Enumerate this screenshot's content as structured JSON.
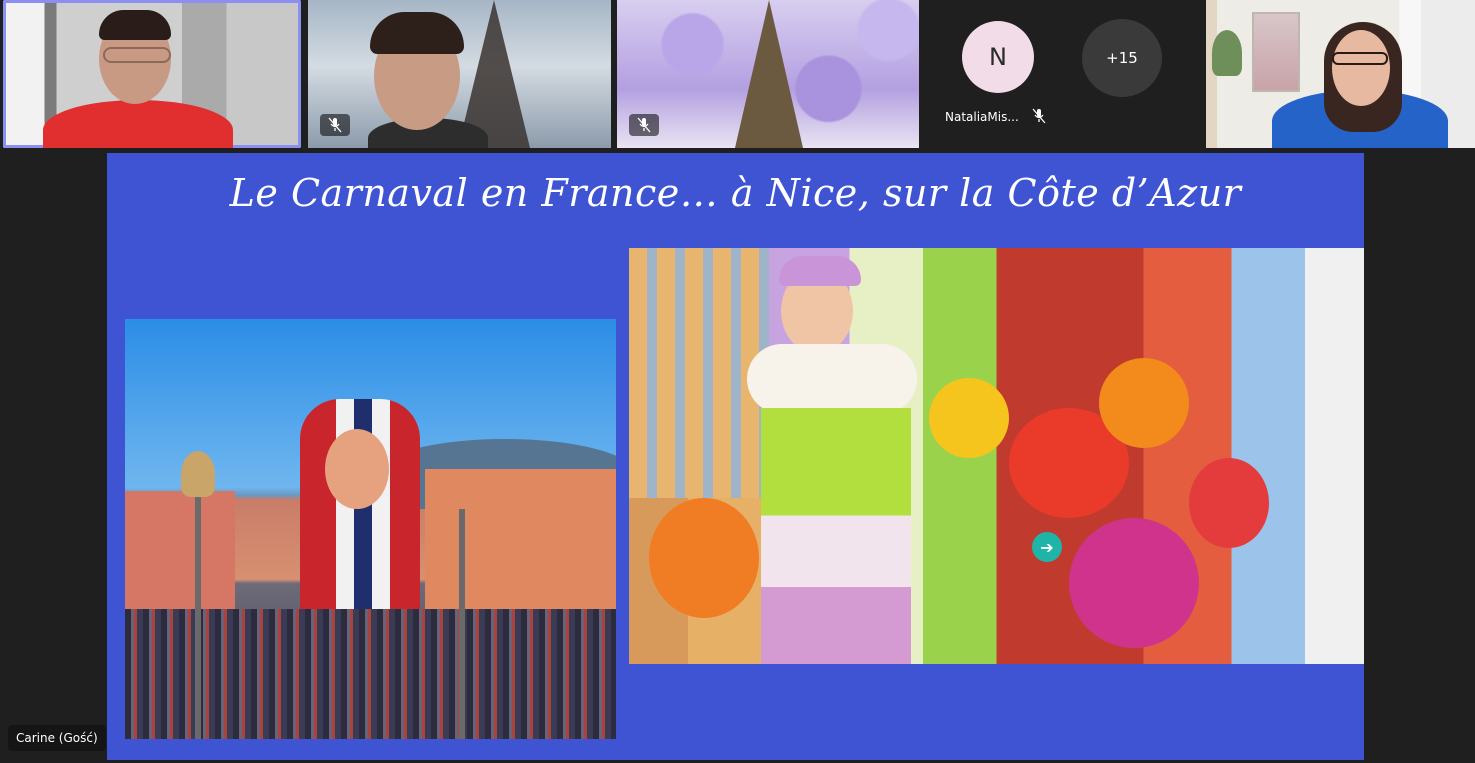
{
  "participants": {
    "tiles": [
      {
        "id": "tile-1",
        "active": true,
        "muted": false
      },
      {
        "id": "tile-2",
        "active": false,
        "muted": true
      },
      {
        "id": "tile-3",
        "active": false,
        "muted": true
      },
      {
        "id": "tile-5",
        "active": false,
        "muted": false
      }
    ],
    "avatar": {
      "initial": "N",
      "name": "NataliaMis...",
      "muted": true
    },
    "overflow_count": "+15"
  },
  "slide": {
    "title": "Le Carnaval en France… à Nice, sur la Côte d’Azur",
    "background_color": "#3e54d3"
  },
  "speaker_label": "Carine (Gość)",
  "colors": {
    "active_outline": "#8b8ff0",
    "background": "#1f1f1f",
    "play_button": "#1fb4a8"
  },
  "icons": {
    "mic_off": "mic-off-icon",
    "play": "arrow-right-icon"
  }
}
